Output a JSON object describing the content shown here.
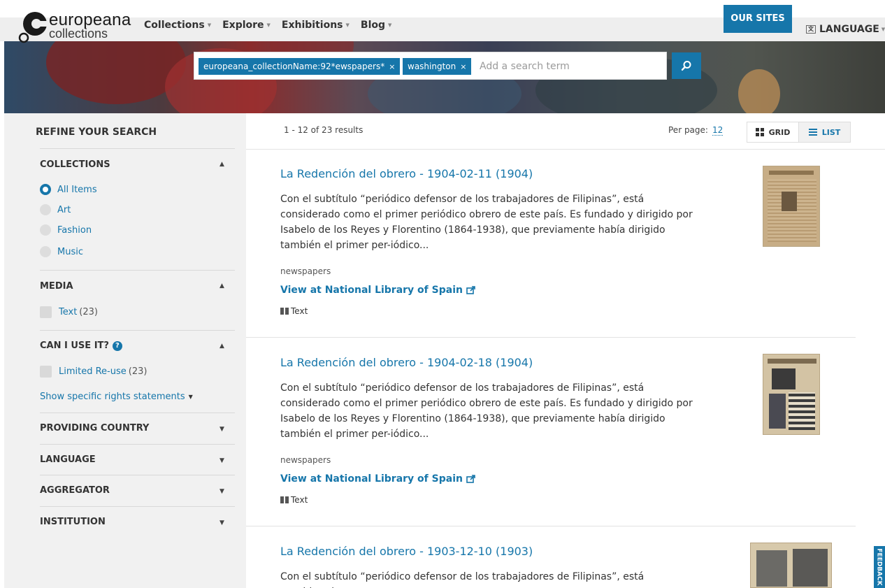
{
  "logo": {
    "line1": "europeana",
    "line2": "collections"
  },
  "nav": {
    "items": [
      {
        "label": "Collections"
      },
      {
        "label": "Explore"
      },
      {
        "label": "Exhibitions"
      },
      {
        "label": "Blog"
      }
    ],
    "our_sites": "OUR SITES",
    "language": "LANGUAGE"
  },
  "search": {
    "pills": [
      {
        "label": "europeana_collectionName:92*ewspapers*"
      },
      {
        "label": "washington"
      }
    ],
    "remove_glyph": "×",
    "placeholder": "Add a search term"
  },
  "sidebar": {
    "title": "REFINE YOUR SEARCH",
    "collections": {
      "title": "COLLECTIONS",
      "options": [
        {
          "label": "All Items",
          "selected": true
        },
        {
          "label": "Art",
          "selected": false
        },
        {
          "label": "Fashion",
          "selected": false
        },
        {
          "label": "Music",
          "selected": false
        }
      ]
    },
    "media": {
      "title": "MEDIA",
      "options": [
        {
          "label": "Text",
          "count": "(23)"
        }
      ]
    },
    "rights": {
      "title": "CAN I USE IT?",
      "options": [
        {
          "label": "Limited Re-use",
          "count": "(23)"
        }
      ],
      "more_link": "Show specific rights statements"
    },
    "collapsed": [
      {
        "title": "PROVIDING COUNTRY"
      },
      {
        "title": "LANGUAGE"
      },
      {
        "title": "AGGREGATOR"
      },
      {
        "title": "INSTITUTION"
      }
    ]
  },
  "results": {
    "summary": "1 - 12 of 23 results",
    "per_page_label": "Per page:",
    "per_page_value": "12",
    "view_grid": "GRID",
    "view_list": "LIST",
    "items": [
      {
        "title": "La Redención del obrero - 1904-02-11 (1904)",
        "description": "Con el subtítulo “periódico defensor de los trabajadores de Filipinas”, está considerado como el primer periódico obrero de este país. Es fundado y dirigido por Isabelo de los Reyes y Florentino (1864-1938), que previamente había dirigido también el primer per-iódico...",
        "type": "newspapers",
        "link": "View at National Library of Spain",
        "media": "Text"
      },
      {
        "title": "La Redención del obrero - 1904-02-18 (1904)",
        "description": "Con el subtítulo “periódico defensor de los trabajadores de Filipinas”, está considerado como el primer periódico obrero de este país. Es fundado y dirigido por Isabelo de los Reyes y Florentino (1864-1938), que previamente había dirigido también el primer per-iódico...",
        "type": "newspapers",
        "link": "View at National Library of Spain",
        "media": "Text"
      },
      {
        "title": "La Redención del obrero - 1903-12-10 (1903)",
        "description": "Con el subtítulo “periódico defensor de los trabajadores de Filipinas”, está considerado",
        "type": "",
        "link": "",
        "media": ""
      }
    ]
  },
  "feedback": "FEEDBACK",
  "colors": {
    "accent": "#1676aa",
    "sidebar_bg": "#f1f1f1"
  }
}
